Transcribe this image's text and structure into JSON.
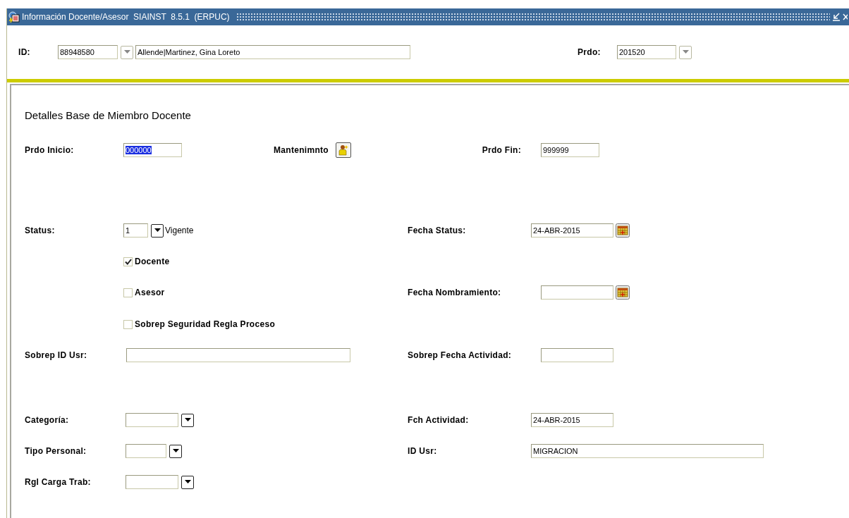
{
  "window": {
    "title": "Información Docente/Asesor  SIAINST  8.5.1  (ERPUC)"
  },
  "key_block": {
    "id_label": "ID:",
    "id_value": "88948580",
    "name_value": "Allende|Martinez, Gina Loreto",
    "term_label": "Prdo:",
    "term_value": "201520"
  },
  "section_title": "Detalles Base de Miembro Docente",
  "term_start": {
    "label": "Prdo Inicio:",
    "value": "000000",
    "highlighted": true
  },
  "maintenance": {
    "label": "Mantenimnto"
  },
  "term_end": {
    "label": "Prdo Fin:",
    "value": "999999"
  },
  "status": {
    "label": "Status:",
    "value": "1",
    "description": "Vigente"
  },
  "status_date": {
    "label": "Fecha Status:",
    "value": "24-ABR-2015"
  },
  "checkboxes": [
    {
      "label": "Docente",
      "checked": true
    },
    {
      "label": "Asesor",
      "checked": false
    },
    {
      "label": "Sobrep Seguridad Regla Proceso",
      "checked": false
    }
  ],
  "appointment_date": {
    "label": "Fecha Nombramiento:"
  },
  "override_user": {
    "label": "Sobrep ID Usr:"
  },
  "override_activity_date": {
    "label": "Sobrep Fecha Actividad:"
  },
  "category": {
    "label": "Categoría:"
  },
  "activity_date": {
    "label": "Fch Actividad:",
    "value": "24-ABR-2015"
  },
  "staff_type": {
    "label": "Tipo Personal:"
  },
  "user_id": {
    "label": "ID Usr:",
    "value": "MIGRACION"
  },
  "workload_rule": {
    "label": "Rgl Carga Trab:"
  }
}
